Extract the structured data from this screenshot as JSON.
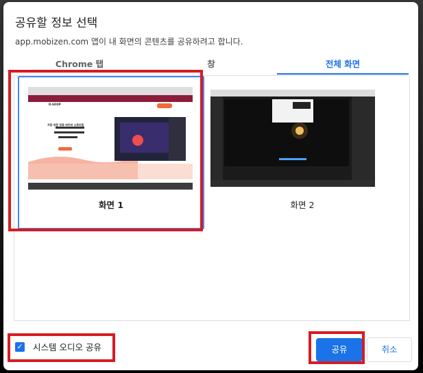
{
  "dialog": {
    "title": "공유할 정보 선택",
    "subtitle": "app.mobizen.com 앱이 내 화면의 콘텐츠를 공유하려고 합니다."
  },
  "tabs": [
    {
      "label": "Chrome 탭",
      "active": false
    },
    {
      "label": "창",
      "active": false
    },
    {
      "label": "전체 화면",
      "active": true
    }
  ],
  "screens": [
    {
      "label": "화면 1",
      "selected": true,
      "thumb": {
        "headline": "가장 쉬운 무료 라이브 스트리밍",
        "brand": "D-SOOP"
      }
    },
    {
      "label": "화면 2",
      "selected": false
    }
  ],
  "audio": {
    "label": "시스템 오디오 공유",
    "checked": true
  },
  "buttons": {
    "share": "공유",
    "cancel": "취소"
  },
  "colors": {
    "accent": "#1a73e8",
    "highlight": "#d81b21"
  }
}
